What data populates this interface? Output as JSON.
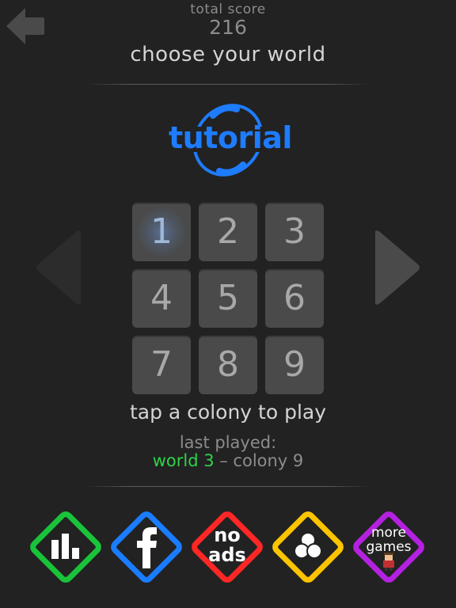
{
  "header": {
    "score_label": "total score",
    "score_value": "216",
    "title": "choose your world"
  },
  "world": {
    "name": "tutorial",
    "color": "#1e7cff"
  },
  "levels": [
    {
      "number": "1",
      "active": true
    },
    {
      "number": "2",
      "active": false
    },
    {
      "number": "3",
      "active": false
    },
    {
      "number": "4",
      "active": false
    },
    {
      "number": "5",
      "active": false
    },
    {
      "number": "6",
      "active": false
    },
    {
      "number": "7",
      "active": false
    },
    {
      "number": "8",
      "active": false
    },
    {
      "number": "9",
      "active": false
    }
  ],
  "hint": "tap a colony to play",
  "last_played": {
    "label": "last played:",
    "world": "world 3",
    "separator": " – ",
    "colony": "colony 9"
  },
  "bottom_buttons": [
    {
      "name": "leaderboard",
      "icon": "bar-chart-icon",
      "color": "#19c43a"
    },
    {
      "name": "facebook",
      "icon": "facebook-icon",
      "color": "#1a7cff"
    },
    {
      "name": "no-ads",
      "label_line1": "no",
      "label_line2": "ads",
      "color": "#ff2626"
    },
    {
      "name": "themes",
      "icon": "three-circles-icon",
      "color": "#ffc400"
    },
    {
      "name": "more-games",
      "label_line1": "more",
      "label_line2": "games",
      "icon": "character-icon",
      "color": "#b521e0"
    }
  ]
}
